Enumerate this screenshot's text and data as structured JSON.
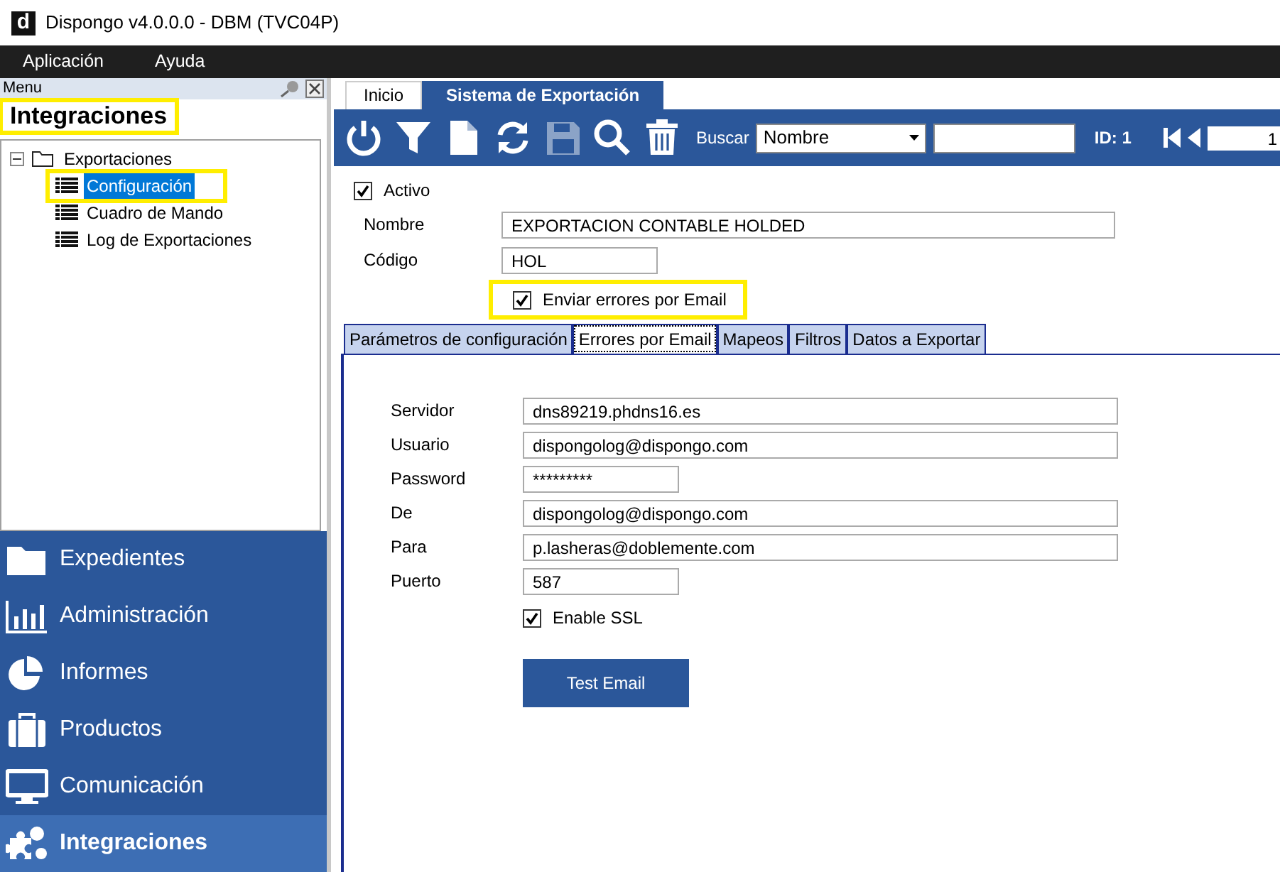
{
  "window": {
    "logo": "d",
    "title": "Dispongo v4.0.0.0 - DBM (TVC04P)"
  },
  "menu_bar": [
    {
      "label": "Aplicación"
    },
    {
      "label": "Ayuda"
    }
  ],
  "side_panel": {
    "header": "Menu",
    "title": "Integraciones",
    "title_highlighted": true,
    "tree": [
      {
        "label": "Exportaciones",
        "expanded": true,
        "children": [
          {
            "label": "Configuración",
            "selected": true,
            "highlighted": true
          },
          {
            "label": "Cuadro de Mando",
            "selected": false,
            "highlighted": false
          },
          {
            "label": "Log de Exportaciones",
            "selected": false,
            "highlighted": false
          }
        ]
      }
    ],
    "nav": [
      {
        "label": "Expedientes",
        "kind": "folder",
        "selected": false
      },
      {
        "label": "Administración",
        "kind": "chart",
        "selected": false
      },
      {
        "label": "Informes",
        "kind": "pie",
        "selected": false
      },
      {
        "label": "Productos",
        "kind": "briefcase",
        "selected": false
      },
      {
        "label": "Comunicación",
        "kind": "monitor",
        "selected": false
      },
      {
        "label": "Integraciones",
        "kind": "puzzle",
        "selected": true
      }
    ]
  },
  "doc_tabs": [
    {
      "label": "Inicio",
      "selected": false
    },
    {
      "label": "Sistema de Exportación",
      "selected": true
    }
  ],
  "toolbar": {
    "buttons": [
      {
        "kind": "power",
        "disabled": false
      },
      {
        "kind": "filter",
        "disabled": false
      },
      {
        "kind": "document",
        "disabled": false
      },
      {
        "kind": "refresh",
        "disabled": false
      },
      {
        "kind": "save",
        "disabled": true
      },
      {
        "kind": "search",
        "disabled": false
      },
      {
        "kind": "trash",
        "disabled": false
      }
    ],
    "search_label": "Buscar",
    "search_by": "Nombre",
    "id_label": "ID: 1",
    "record_value": "1"
  },
  "form": {
    "active": {
      "label": "Activo",
      "checked": true
    },
    "fields": [
      {
        "label": "Nombre",
        "value": "EXPORTACION CONTABLE HOLDED",
        "kind": "wide"
      },
      {
        "label": "Código",
        "value": "HOL",
        "kind": "short"
      }
    ],
    "send_errors": {
      "label": "Enviar errores por Email",
      "checked": true,
      "highlighted": true
    }
  },
  "sub_tabs": [
    {
      "label": "Parámetros de configuración",
      "selected": false
    },
    {
      "label": "Errores por Email",
      "selected": true
    },
    {
      "label": "Mapeos",
      "selected": false
    },
    {
      "label": "Filtros",
      "selected": false
    },
    {
      "label": "Datos a Exportar",
      "selected": false
    }
  ],
  "email": {
    "fields": [
      {
        "label": "Servidor",
        "value": "dns89219.phdns16.es",
        "kind": "wide"
      },
      {
        "label": "Usuario",
        "value": "dispongolog@dispongo.com",
        "kind": "wide"
      },
      {
        "label": "Password",
        "value": "*********",
        "kind": "short"
      },
      {
        "label": "De",
        "value": "dispongolog@dispongo.com",
        "kind": "wide"
      },
      {
        "label": "Para",
        "value": "p.lasheras@doblemente.com",
        "kind": "wide"
      },
      {
        "label": "Puerto",
        "value": "587",
        "kind": "short"
      }
    ],
    "ssl": {
      "label": "Enable SSL",
      "checked": true
    },
    "test_button": "Test Email"
  }
}
